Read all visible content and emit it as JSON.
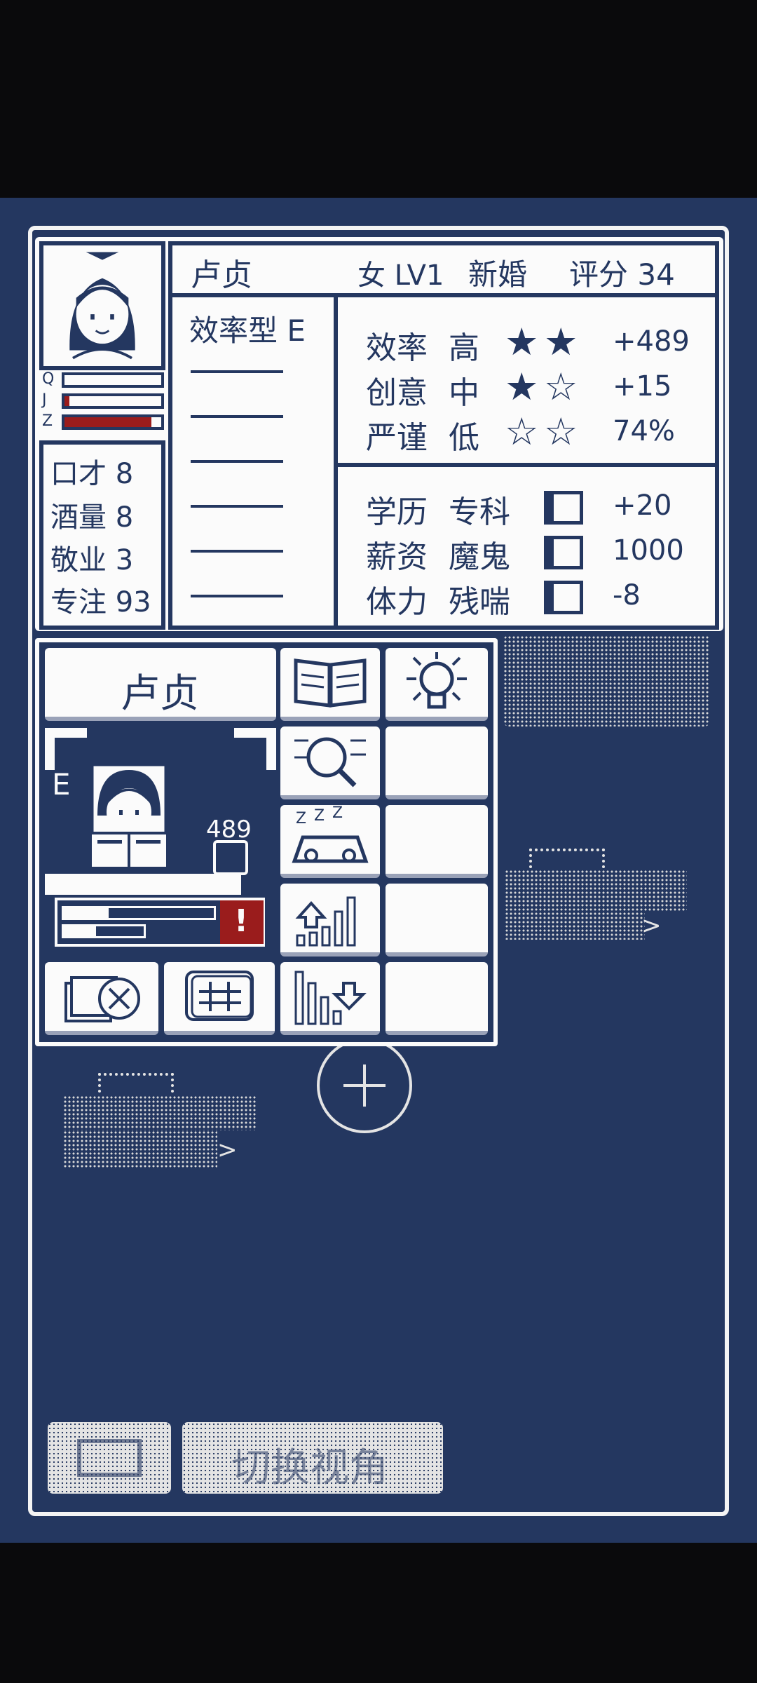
{
  "character": {
    "name": "卢贞",
    "gender_level": "女 LV1",
    "status": "新婚",
    "rating_label": "评分",
    "rating_value": "34",
    "bar_labels": [
      "Q",
      "J",
      "Z"
    ],
    "bar_levels": [
      0.0,
      0.05,
      0.9
    ],
    "type": "效率型 E",
    "attributes": [
      {
        "label": "口才",
        "value": "8"
      },
      {
        "label": "酒量",
        "value": "8"
      },
      {
        "label": "敬业",
        "value": "3"
      },
      {
        "label": "专注",
        "value": "93"
      }
    ],
    "stats": [
      {
        "label": "效率",
        "level": "高",
        "stars": 2,
        "value": "+489"
      },
      {
        "label": "创意",
        "level": "中",
        "stars": 1,
        "value": "+15"
      },
      {
        "label": "严谨",
        "level": "低",
        "stars": 0,
        "value": "74%"
      }
    ],
    "details": [
      {
        "label": "学历",
        "value": "专科",
        "amount": "+20"
      },
      {
        "label": "薪资",
        "value": "魔鬼",
        "amount": "1000"
      },
      {
        "label": "体力",
        "value": "残喘",
        "amount": "-8"
      }
    ]
  },
  "popup": {
    "name_button": "卢贞",
    "grade": "E",
    "output_value": "489",
    "alert": "!",
    "icons": [
      "book-icon",
      "lightbulb-icon",
      "magnify-icon",
      "sleep-icon",
      "upgrade-icon",
      "discard-icon",
      "grid-icon",
      "downgrade-icon"
    ]
  },
  "bottom": {
    "switch_view_label": "切换视角"
  },
  "colors": {
    "navy": "#243760",
    "white": "#fbfbfb",
    "red": "#9a1c1c",
    "black": "#0a0a0c"
  }
}
